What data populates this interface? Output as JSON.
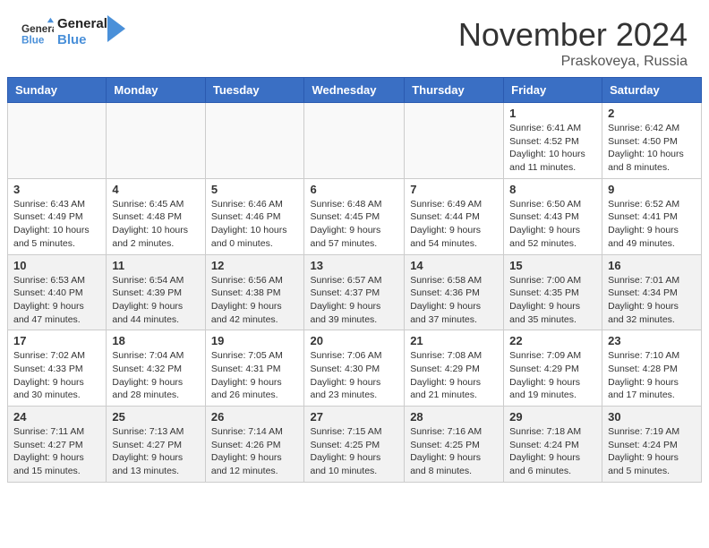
{
  "header": {
    "logo_text_general": "General",
    "logo_text_blue": "Blue",
    "month_title": "November 2024",
    "location": "Praskoveya, Russia"
  },
  "days_of_week": [
    "Sunday",
    "Monday",
    "Tuesday",
    "Wednesday",
    "Thursday",
    "Friday",
    "Saturday"
  ],
  "weeks": [
    [
      {
        "day": "",
        "empty": true
      },
      {
        "day": "",
        "empty": true
      },
      {
        "day": "",
        "empty": true
      },
      {
        "day": "",
        "empty": true
      },
      {
        "day": "",
        "empty": true
      },
      {
        "day": "1",
        "sunrise": "6:41 AM",
        "sunset": "4:52 PM",
        "daylight": "10 hours and 11 minutes."
      },
      {
        "day": "2",
        "sunrise": "6:42 AM",
        "sunset": "4:50 PM",
        "daylight": "10 hours and 8 minutes."
      }
    ],
    [
      {
        "day": "3",
        "sunrise": "6:43 AM",
        "sunset": "4:49 PM",
        "daylight": "10 hours and 5 minutes."
      },
      {
        "day": "4",
        "sunrise": "6:45 AM",
        "sunset": "4:48 PM",
        "daylight": "10 hours and 2 minutes."
      },
      {
        "day": "5",
        "sunrise": "6:46 AM",
        "sunset": "4:46 PM",
        "daylight": "10 hours and 0 minutes."
      },
      {
        "day": "6",
        "sunrise": "6:48 AM",
        "sunset": "4:45 PM",
        "daylight": "9 hours and 57 minutes."
      },
      {
        "day": "7",
        "sunrise": "6:49 AM",
        "sunset": "4:44 PM",
        "daylight": "9 hours and 54 minutes."
      },
      {
        "day": "8",
        "sunrise": "6:50 AM",
        "sunset": "4:43 PM",
        "daylight": "9 hours and 52 minutes."
      },
      {
        "day": "9",
        "sunrise": "6:52 AM",
        "sunset": "4:41 PM",
        "daylight": "9 hours and 49 minutes."
      }
    ],
    [
      {
        "day": "10",
        "sunrise": "6:53 AM",
        "sunset": "4:40 PM",
        "daylight": "9 hours and 47 minutes."
      },
      {
        "day": "11",
        "sunrise": "6:54 AM",
        "sunset": "4:39 PM",
        "daylight": "9 hours and 44 minutes."
      },
      {
        "day": "12",
        "sunrise": "6:56 AM",
        "sunset": "4:38 PM",
        "daylight": "9 hours and 42 minutes."
      },
      {
        "day": "13",
        "sunrise": "6:57 AM",
        "sunset": "4:37 PM",
        "daylight": "9 hours and 39 minutes."
      },
      {
        "day": "14",
        "sunrise": "6:58 AM",
        "sunset": "4:36 PM",
        "daylight": "9 hours and 37 minutes."
      },
      {
        "day": "15",
        "sunrise": "7:00 AM",
        "sunset": "4:35 PM",
        "daylight": "9 hours and 35 minutes."
      },
      {
        "day": "16",
        "sunrise": "7:01 AM",
        "sunset": "4:34 PM",
        "daylight": "9 hours and 32 minutes."
      }
    ],
    [
      {
        "day": "17",
        "sunrise": "7:02 AM",
        "sunset": "4:33 PM",
        "daylight": "9 hours and 30 minutes."
      },
      {
        "day": "18",
        "sunrise": "7:04 AM",
        "sunset": "4:32 PM",
        "daylight": "9 hours and 28 minutes."
      },
      {
        "day": "19",
        "sunrise": "7:05 AM",
        "sunset": "4:31 PM",
        "daylight": "9 hours and 26 minutes."
      },
      {
        "day": "20",
        "sunrise": "7:06 AM",
        "sunset": "4:30 PM",
        "daylight": "9 hours and 23 minutes."
      },
      {
        "day": "21",
        "sunrise": "7:08 AM",
        "sunset": "4:29 PM",
        "daylight": "9 hours and 21 minutes."
      },
      {
        "day": "22",
        "sunrise": "7:09 AM",
        "sunset": "4:29 PM",
        "daylight": "9 hours and 19 minutes."
      },
      {
        "day": "23",
        "sunrise": "7:10 AM",
        "sunset": "4:28 PM",
        "daylight": "9 hours and 17 minutes."
      }
    ],
    [
      {
        "day": "24",
        "sunrise": "7:11 AM",
        "sunset": "4:27 PM",
        "daylight": "9 hours and 15 minutes."
      },
      {
        "day": "25",
        "sunrise": "7:13 AM",
        "sunset": "4:27 PM",
        "daylight": "9 hours and 13 minutes."
      },
      {
        "day": "26",
        "sunrise": "7:14 AM",
        "sunset": "4:26 PM",
        "daylight": "9 hours and 12 minutes."
      },
      {
        "day": "27",
        "sunrise": "7:15 AM",
        "sunset": "4:25 PM",
        "daylight": "9 hours and 10 minutes."
      },
      {
        "day": "28",
        "sunrise": "7:16 AM",
        "sunset": "4:25 PM",
        "daylight": "9 hours and 8 minutes."
      },
      {
        "day": "29",
        "sunrise": "7:18 AM",
        "sunset": "4:24 PM",
        "daylight": "9 hours and 6 minutes."
      },
      {
        "day": "30",
        "sunrise": "7:19 AM",
        "sunset": "4:24 PM",
        "daylight": "9 hours and 5 minutes."
      }
    ]
  ]
}
